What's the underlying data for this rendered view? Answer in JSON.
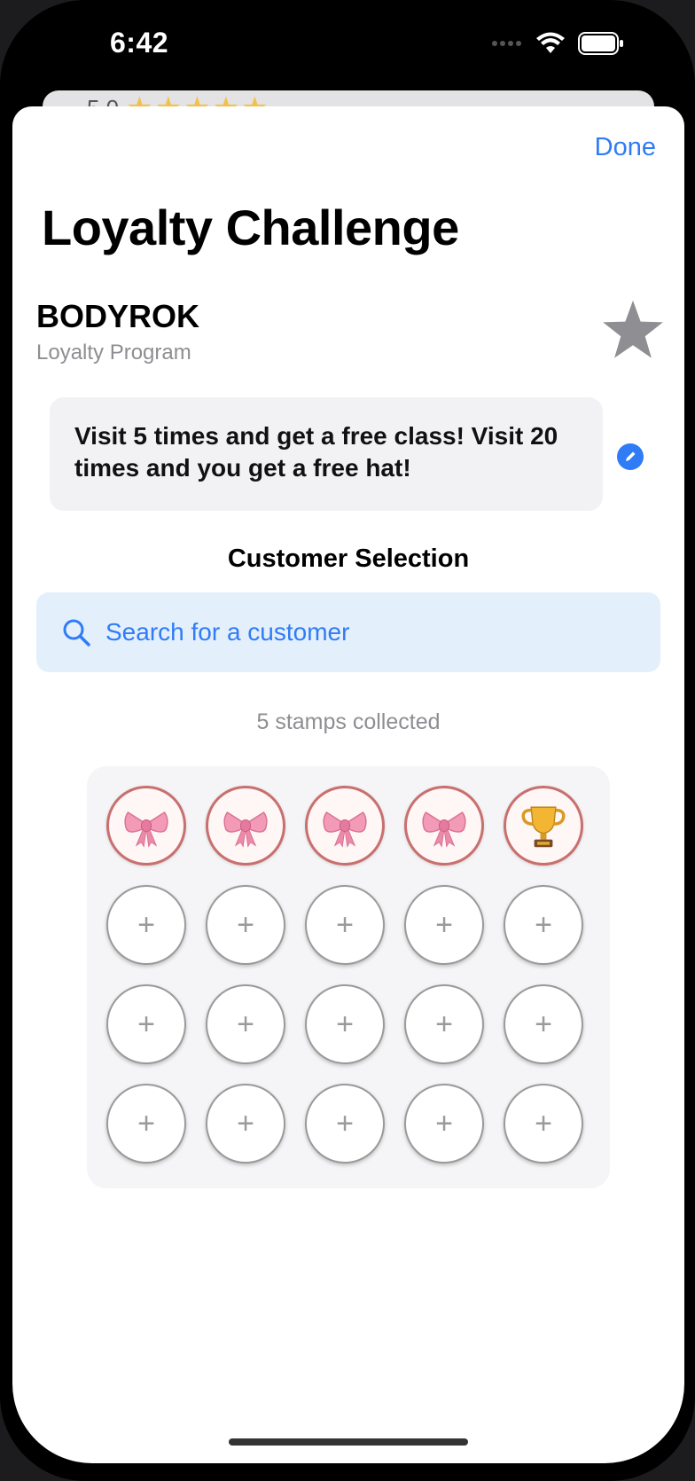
{
  "status_bar": {
    "time": "6:42"
  },
  "background_card": {
    "rating": "5.0"
  },
  "header": {
    "done_label": "Done",
    "title": "Loyalty Challenge"
  },
  "program": {
    "name": "BODYROK",
    "subtitle": "Loyalty Program"
  },
  "description": {
    "text": "Visit 5 times and get a free class! Visit 20 times and you get a free hat!"
  },
  "customer_section": {
    "title": "Customer Selection",
    "search_placeholder": "Search for a customer"
  },
  "stamps": {
    "collected_label": "5 stamps collected",
    "collected": 5,
    "total": 20,
    "filled_icons": [
      "bow",
      "bow",
      "bow",
      "bow",
      "trophy"
    ]
  },
  "colors": {
    "accent": "#2f7cf6",
    "stamp_border": "#c8706e",
    "search_bg": "#e4effc"
  }
}
